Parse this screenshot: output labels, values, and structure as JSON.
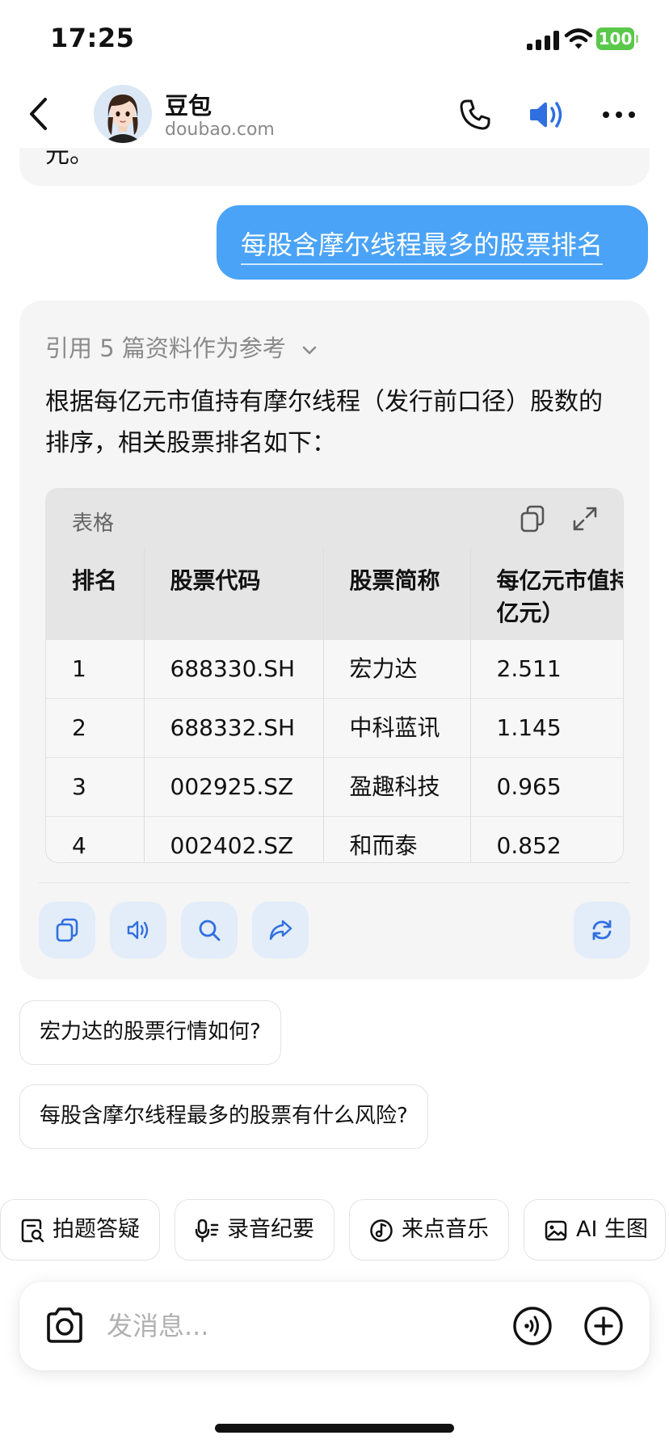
{
  "status_bar": {
    "time": "17:25",
    "battery": "100"
  },
  "header": {
    "title": "豆包",
    "subtitle": "doubao.com"
  },
  "previous_message_tail": "元。",
  "user_message": "每股含摩尔线程最多的股票排名",
  "answer": {
    "refs_label": "引用 5 篇资料作为参考",
    "text": "根据每亿元市值持有摩尔线程（发行前口径）股数的排序，相关股票排名如下：",
    "table": {
      "bar_label": "表格",
      "headers": [
        "排名",
        "股票代码",
        "股票简称",
        "每亿元市值持\n亿元）"
      ],
      "rows": [
        [
          "1",
          "688330.SH",
          "宏力达",
          "2.511"
        ],
        [
          "2",
          "688332.SH",
          "中科蓝讯",
          "1.145"
        ],
        [
          "3",
          "002925.SZ",
          "盈趣科技",
          "0.965"
        ],
        [
          "4",
          "002402.SZ",
          "和而泰",
          "0.852"
        ]
      ]
    }
  },
  "suggestions": [
    "宏力达的股票行情如何?",
    "每股含摩尔线程最多的股票有什么风险?"
  ],
  "quick_actions": [
    "拍题答疑",
    "录音纪要",
    "来点音乐",
    "AI 生图"
  ],
  "composer": {
    "placeholder": "发消息..."
  },
  "colors": {
    "accent": "#4aa3f6",
    "icon_blue": "#2f6fe0",
    "action_bg": "#e3ecf9"
  },
  "icons": {
    "header": [
      "back-icon",
      "phone-icon",
      "speaker-icon",
      "more-icon"
    ],
    "actions": [
      "copy-icon",
      "read-aloud-icon",
      "search-icon",
      "share-icon",
      "regenerate-icon"
    ],
    "quick": [
      "photo-search-icon",
      "microphone-icon",
      "music-icon",
      "image-icon"
    ],
    "composer": [
      "camera-icon",
      "voice-call-icon",
      "plus-icon"
    ]
  }
}
